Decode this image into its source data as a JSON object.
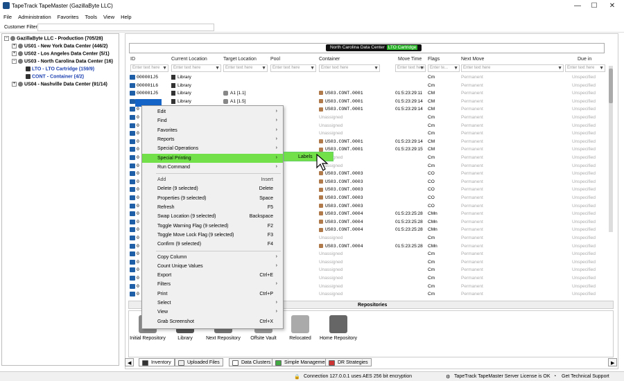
{
  "window": {
    "title": "TapeTrack TapeMaster (GazillaByte LLC)",
    "min": "—",
    "max": "☐",
    "close": "✕"
  },
  "menu": [
    "File",
    "Administration",
    "Favorites",
    "Tools",
    "View",
    "Help"
  ],
  "filter": {
    "label": "Customer Filter",
    "value": ""
  },
  "tree": {
    "root": "GazillaByte LLC - Production (705/28)",
    "nodes": [
      "US01 - New York Data Center (446/2)",
      "US02 - Los Angeles Data Center (5/1)",
      "US03 - North Carolina Data Center (16)",
      "LTO - LTO Cartridge (159/9)",
      "CONT - Container (4/2)",
      "US04 - Nashville Data Center (91/14)"
    ]
  },
  "banner": {
    "location": "North Carolina Data Center",
    "media": "LTO Cartridge"
  },
  "columns": [
    {
      "name": "ID",
      "placeholder": "Enter text here"
    },
    {
      "name": "Current Location",
      "placeholder": "Enter text here"
    },
    {
      "name": "Target Location",
      "placeholder": "Enter text here"
    },
    {
      "name": "Pool",
      "placeholder": "Enter text here"
    },
    {
      "name": "Container",
      "placeholder": "Enter text here"
    },
    {
      "name": "Move Time",
      "placeholder": "Enter text here"
    },
    {
      "name": "Flags",
      "placeholder": "Enter te..."
    },
    {
      "name": "Next Move",
      "placeholder": "Enter text here"
    },
    {
      "name": "Due in",
      "placeholder": "Enter text here"
    }
  ],
  "rows": [
    {
      "id": "000001J5",
      "cur": "Library",
      "tgt": "",
      "cont": "",
      "time": "",
      "flags": "Cm",
      "next": "Permanent",
      "due": "Unspecified"
    },
    {
      "id": "000001L6",
      "cur": "Library",
      "tgt": "",
      "cont": "",
      "time": "",
      "flags": "Cm",
      "next": "Permanent",
      "due": "Unspecified"
    },
    {
      "id": "000001J5",
      "cur": "Library",
      "tgt": "A1 [1.1]",
      "cont": "US03.CONT.0001",
      "time": "01:5:23:29:11",
      "flags": "CM",
      "next": "Permanent",
      "due": "Unspecified"
    },
    {
      "id": "000001J5",
      "cur": "Library",
      "tgt": "A1 [1.5]",
      "cont": "US03.CONT.0001",
      "time": "01:5:23:29:14",
      "flags": "CM",
      "next": "Permanent",
      "due": "Unspecified"
    },
    {
      "id": "0",
      "cur": "",
      "tgt": "",
      "cont": "US03.CONT.0001",
      "time": "01:5:23:29:14",
      "flags": "CM",
      "next": "Permanent",
      "due": "Unspecified"
    },
    {
      "id": "0",
      "cur": "",
      "tgt": "",
      "cont": "Unassigned",
      "time": "",
      "flags": "Cm",
      "next": "Permanent",
      "due": "Unspecified"
    },
    {
      "id": "0",
      "cur": "",
      "tgt": "",
      "cont": "Unassigned",
      "time": "",
      "flags": "Cm",
      "next": "Permanent",
      "due": "Unspecified"
    },
    {
      "id": "0",
      "cur": "",
      "tgt": "",
      "cont": "Unassigned",
      "time": "",
      "flags": "Cm",
      "next": "Permanent",
      "due": "Unspecified"
    },
    {
      "id": "0",
      "cur": "",
      "tgt": "",
      "cont": "US03.CONT.0001",
      "time": "01:5:23:29:14",
      "flags": "CM",
      "next": "Permanent",
      "due": "Unspecified"
    },
    {
      "id": "0",
      "cur": "",
      "tgt": "",
      "cont": "US03.CONT.0001",
      "time": "01:5:23:29:15",
      "flags": "CM",
      "next": "Permanent",
      "due": "Unspecified"
    },
    {
      "id": "0",
      "cur": "",
      "tgt": "",
      "cont": "Unassigned",
      "time": "",
      "flags": "Cm",
      "next": "Permanent",
      "due": "Unspecified"
    },
    {
      "id": "0",
      "cur": "",
      "tgt": "",
      "cont": "Unassigned",
      "time": "",
      "flags": "Cm",
      "next": "Permanent",
      "due": "Unspecified"
    },
    {
      "id": "0",
      "cur": "",
      "tgt": "",
      "cont": "US03.CONT.0003",
      "time": "",
      "flags": "CO",
      "next": "Permanent",
      "due": "Unspecified"
    },
    {
      "id": "0",
      "cur": "",
      "tgt": "",
      "cont": "US03.CONT.0003",
      "time": "",
      "flags": "CO",
      "next": "Permanent",
      "due": "Unspecified"
    },
    {
      "id": "0",
      "cur": "",
      "tgt": "",
      "cont": "US03.CONT.0003",
      "time": "",
      "flags": "CO",
      "next": "Permanent",
      "due": "Unspecified"
    },
    {
      "id": "0",
      "cur": "",
      "tgt": "",
      "cont": "US03.CONT.0003",
      "time": "",
      "flags": "CO",
      "next": "Permanent",
      "due": "Unspecified"
    },
    {
      "id": "0",
      "cur": "",
      "tgt": "",
      "cont": "US03.CONT.0003",
      "time": "",
      "flags": "CO",
      "next": "Permanent",
      "due": "Unspecified"
    },
    {
      "id": "0",
      "cur": "",
      "tgt": "",
      "cont": "US03.CONT.0004",
      "time": "01:5:23:25:28",
      "flags": "CMn",
      "next": "Permanent",
      "due": "Unspecified"
    },
    {
      "id": "0",
      "cur": "",
      "tgt": "",
      "cont": "US03.CONT.0004",
      "time": "01:5:23:25:28",
      "flags": "CMn",
      "next": "Permanent",
      "due": "Unspecified"
    },
    {
      "id": "0",
      "cur": "",
      "tgt": "",
      "cont": "US03.CONT.0004",
      "time": "01:5:23:25:28",
      "flags": "CMn",
      "next": "Permanent",
      "due": "Unspecified"
    },
    {
      "id": "0",
      "cur": "",
      "tgt": "",
      "cont": "Unassigned",
      "time": "",
      "flags": "Cm",
      "next": "Permanent",
      "due": "Unspecified"
    },
    {
      "id": "0",
      "cur": "",
      "tgt": "",
      "cont": "US03.CONT.0004",
      "time": "01:5:23:25:28",
      "flags": "CMn",
      "next": "Permanent",
      "due": "Unspecified"
    },
    {
      "id": "0",
      "cur": "",
      "tgt": "",
      "cont": "Unassigned",
      "time": "",
      "flags": "Cm",
      "next": "Permanent",
      "due": "Unspecified"
    },
    {
      "id": "0",
      "cur": "",
      "tgt": "",
      "cont": "Unassigned",
      "time": "",
      "flags": "Cm",
      "next": "Permanent",
      "due": "Unspecified"
    },
    {
      "id": "0",
      "cur": "",
      "tgt": "",
      "cont": "Unassigned",
      "time": "",
      "flags": "Cm",
      "next": "Permanent",
      "due": "Unspecified"
    },
    {
      "id": "0",
      "cur": "",
      "tgt": "",
      "cont": "Unassigned",
      "time": "",
      "flags": "Cm",
      "next": "Permanent",
      "due": "Unspecified"
    },
    {
      "id": "0",
      "cur": "",
      "tgt": "",
      "cont": "Unassigned",
      "time": "",
      "flags": "Cm",
      "next": "Permanent",
      "due": "Unspecified"
    },
    {
      "id": "0",
      "cur": "",
      "tgt": "",
      "cont": "Unassigned",
      "time": "",
      "flags": "Cm",
      "next": "Permanent",
      "due": "Unspecified"
    },
    {
      "id": "0",
      "cur": "",
      "tgt": "",
      "cont": "Unassigned",
      "time": "",
      "flags": "Cm",
      "next": "Permanent",
      "due": "Unspecified"
    }
  ],
  "context_menu": [
    {
      "label": "Edit",
      "shortcut": "",
      "arrow": true
    },
    {
      "label": "Find",
      "shortcut": "",
      "arrow": true
    },
    {
      "label": "Favorites",
      "shortcut": "",
      "arrow": true
    },
    {
      "label": "Reports",
      "shortcut": "",
      "arrow": true
    },
    {
      "label": "Special Operations",
      "shortcut": "",
      "arrow": true
    },
    {
      "label": "Special Printing",
      "shortcut": "",
      "arrow": true,
      "highlight": true
    },
    {
      "label": "Run Command",
      "shortcut": "",
      "arrow": true,
      "sep": true
    },
    {
      "label": "Add",
      "shortcut": "Insert",
      "arrow": false,
      "dim": true
    },
    {
      "label": "Delete (9 selected)",
      "shortcut": "Delete",
      "arrow": false
    },
    {
      "label": "Properties (9 selected)",
      "shortcut": "Space",
      "arrow": false
    },
    {
      "label": "Refresh",
      "shortcut": "F5",
      "arrow": false
    },
    {
      "label": "Swap Location (9 selected)",
      "shortcut": "Backspace",
      "arrow": false
    },
    {
      "label": "Toggle Warning Flag (9 selected)",
      "shortcut": "F2",
      "arrow": false
    },
    {
      "label": "Toggle Move Lock Flag (9 selected)",
      "shortcut": "F3",
      "arrow": false
    },
    {
      "label": "Confirm (9 selected)",
      "shortcut": "F4",
      "arrow": false,
      "sep": true
    },
    {
      "label": "Copy Column",
      "shortcut": "",
      "arrow": true
    },
    {
      "label": "Count Unique Values",
      "shortcut": "",
      "arrow": true
    },
    {
      "label": "Export",
      "shortcut": "Ctrl+E",
      "arrow": false
    },
    {
      "label": "Filters",
      "shortcut": "",
      "arrow": true
    },
    {
      "label": "Print",
      "shortcut": "Ctrl+P",
      "arrow": false
    },
    {
      "label": "Select",
      "shortcut": "",
      "arrow": true
    },
    {
      "label": "View",
      "shortcut": "",
      "arrow": true
    },
    {
      "label": "Grab Screenshot",
      "shortcut": "Ctrl+X",
      "arrow": false
    }
  ],
  "submenu": {
    "label": "Labels"
  },
  "repositories": {
    "title": "Repositories",
    "items": [
      "Initial Repository",
      "Library",
      "Next Repository",
      "Offsite Vault",
      "Relocated",
      "Home Repository"
    ]
  },
  "tabs": [
    "Inventory",
    "Uploaded Files",
    "Data Clusters",
    "Simple Management",
    "DR Strategies"
  ],
  "status": {
    "connection": "Connection 127.0.0.1 uses AES 256 bit encryption",
    "license": "TapeTrack TapeMaster Server License is OK",
    "support": "Get Technical Support"
  }
}
